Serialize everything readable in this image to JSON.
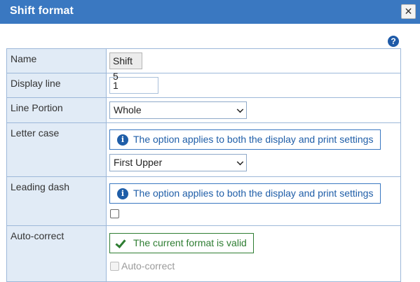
{
  "dialog": {
    "title": "Shift format",
    "close_glyph": "✕",
    "help_glyph": "?"
  },
  "rows": {
    "name": {
      "label": "Name",
      "value": "Shift 5"
    },
    "display_line": {
      "label": "Display line",
      "value": "1"
    },
    "line_portion": {
      "label": "Line Portion",
      "selected": "Whole"
    },
    "letter_case": {
      "label": "Letter case",
      "info": "The option applies to both the display and print settings",
      "selected": "First Upper"
    },
    "leading_dash": {
      "label": "Leading dash",
      "info": "The option applies to both the display and print settings",
      "checked": false
    },
    "auto_correct": {
      "label": "Auto-correct",
      "status": "The current format is valid",
      "checkbox_label": "Auto-correct",
      "checked": false
    }
  },
  "icons": {
    "info": "info-icon",
    "valid": "checkmark-icon",
    "help": "help-icon",
    "close": "close-icon"
  },
  "colors": {
    "titlebar": "#3a78c1",
    "label_bg": "#e1ebf6",
    "info": "#1f5ea8",
    "valid": "#2e7d32"
  }
}
